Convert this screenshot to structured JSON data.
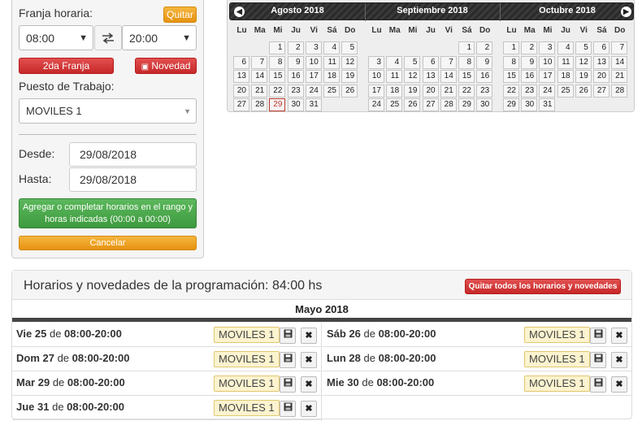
{
  "left_panel": {
    "franja_label": "Franja horaria:",
    "quitar_label": "Quitar",
    "start_time": "08:00",
    "end_time": "20:00",
    "swap_icon": "swap-arrows-icon",
    "segunda_franja_label": "2da Franja",
    "novedad_label": "Novedad",
    "novedad_icon": "document-icon",
    "puesto_label": "Puesto de Trabajo:",
    "puesto_value": "MOVILES 1",
    "desde_label": "Desde:",
    "desde_value": "29/08/2018",
    "hasta_label": "Hasta:",
    "hasta_value": "29/08/2018",
    "agregar_line1": "Agregar o completar horarios en el rango y",
    "agregar_line2": "horas indicadas (00:00 a 00:00)",
    "cancelar_label": "Cancelar"
  },
  "calendar": {
    "prev_icon": "chevron-left-icon",
    "next_icon": "chevron-right-icon",
    "dow": [
      "Lu",
      "Ma",
      "Mi",
      "Ju",
      "Vi",
      "Sá",
      "Do"
    ],
    "months": [
      {
        "title": "Agosto 2018",
        "offset": 2,
        "days": 31,
        "today": 29
      },
      {
        "title": "Septiembre 2018",
        "offset": 5,
        "days": 30,
        "today": null
      },
      {
        "title": "Octubre 2018",
        "offset": 0,
        "days": 31,
        "today": null
      }
    ]
  },
  "schedule": {
    "title": "Horarios y novedades de la programación: 84:00 hs",
    "remove_all_label": "Quitar todos los horarios y novedades",
    "month_label": "Mayo 2018",
    "save_icon": "floppy-disk-icon",
    "delete_icon": "close-icon",
    "entries": [
      {
        "day": "Vie 25",
        "de": "de",
        "range": "08:00-20:00",
        "tag": "MOVILES 1"
      },
      {
        "day": "Sáb 26",
        "de": "de",
        "range": "08:00-20:00",
        "tag": "MOVILES 1"
      },
      {
        "day": "Dom 27",
        "de": "de",
        "range": "08:00-20:00",
        "tag": "MOVILES 1"
      },
      {
        "day": "Lun 28",
        "de": "de",
        "range": "08:00-20:00",
        "tag": "MOVILES 1"
      },
      {
        "day": "Mar 29",
        "de": "de",
        "range": "08:00-20:00",
        "tag": "MOVILES 1"
      },
      {
        "day": "Mie 30",
        "de": "de",
        "range": "08:00-20:00",
        "tag": "MOVILES 1"
      },
      {
        "day": "Jue 31",
        "de": "de",
        "range": "08:00-20:00",
        "tag": "MOVILES 1"
      }
    ]
  }
}
